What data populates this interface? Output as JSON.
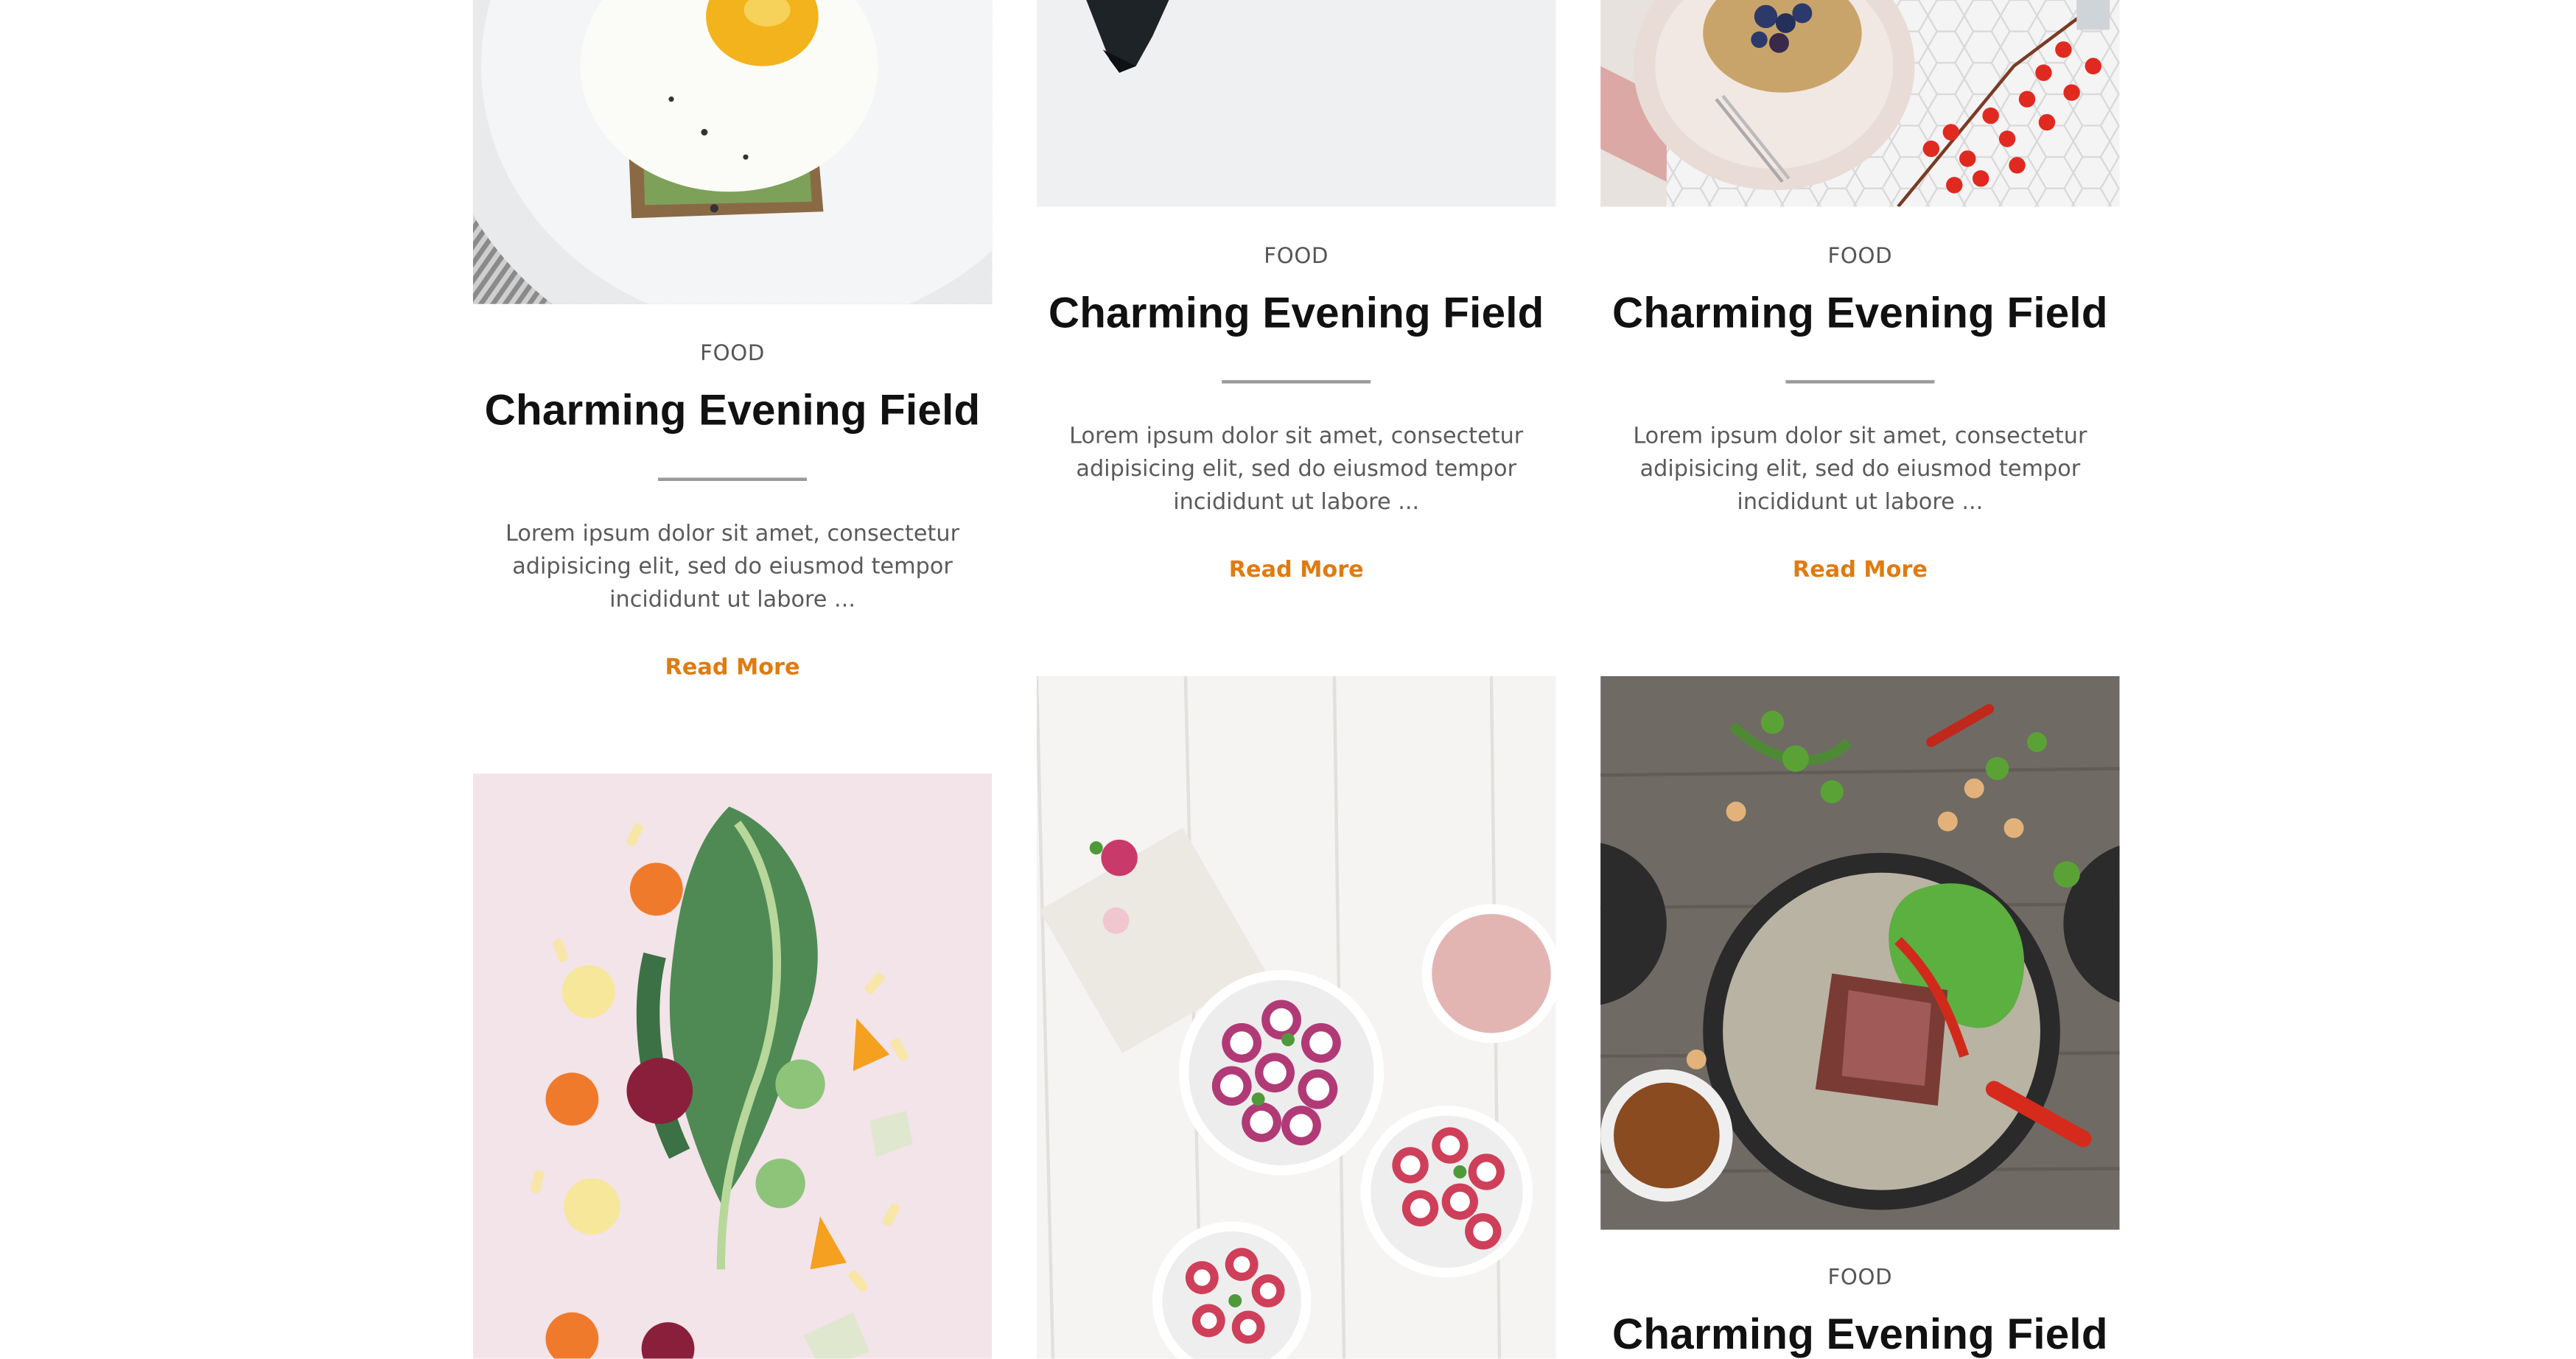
{
  "posts": [
    {
      "category": "FOOD",
      "title": "Charming Evening Field",
      "excerpt": "Lorem ipsum dolor sit amet, consectetur adipisicing elit, sed do eiusmod tempor incididunt ut labore ...",
      "read_more": "Read More",
      "image": "egg-avocado-toast-photo"
    },
    {
      "category": "FOOD",
      "title": "Charming Evening Field",
      "excerpt": "Lorem ipsum dolor sit amet, consectetur adipisicing elit, sed do eiusmod tempor incididunt ut labore ...",
      "read_more": "Read More",
      "image": "white-table-photo"
    },
    {
      "category": "FOOD",
      "title": "Charming Evening Field",
      "excerpt": "Lorem ipsum dolor sit amet, consectetur adipisicing elit, sed do eiusmod tempor incididunt ut labore ...",
      "read_more": "Read More",
      "image": "berry-dessert-plate-photo"
    },
    {
      "image": "kale-vegetables-photo"
    },
    {
      "image": "radish-salad-bowls-photo"
    },
    {
      "category": "FOOD",
      "title": "Charming Evening Field",
      "image": "steak-salad-bowl-photo"
    }
  ],
  "colors": {
    "accent": "#e07b10",
    "heading": "#111111",
    "body_text": "#5a5a5a",
    "divider": "#9a9a9a"
  }
}
